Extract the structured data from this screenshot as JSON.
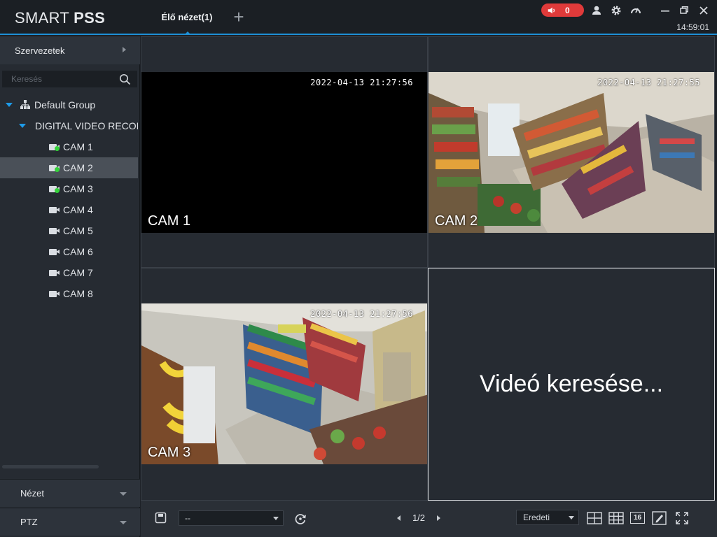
{
  "app": {
    "logo_light": "SMART",
    "logo_bold": "PSS",
    "clock": "14:59:01"
  },
  "tabs": [
    {
      "label": "Élő nézet(1)"
    }
  ],
  "alarm": {
    "count": "0",
    "color": "#e03a3a"
  },
  "accent_color": "#1e90d6",
  "sidebar": {
    "organizations_label": "Szervezetek",
    "search_placeholder": "Keresés",
    "tree": {
      "group": "Default Group",
      "device": "DIGITAL VIDEO RECORDER",
      "cameras": [
        {
          "label": "CAM 1",
          "online": true
        },
        {
          "label": "CAM 2",
          "online": true,
          "selected": true
        },
        {
          "label": "CAM 3",
          "online": true
        },
        {
          "label": "CAM 4",
          "online": false
        },
        {
          "label": "CAM 5",
          "online": false
        },
        {
          "label": "CAM 6",
          "online": false
        },
        {
          "label": "CAM 7",
          "online": false
        },
        {
          "label": "CAM 8",
          "online": false
        }
      ]
    },
    "view_label": "Nézet",
    "ptz_label": "PTZ"
  },
  "video": {
    "tiles": [
      {
        "camera": "CAM 1",
        "timestamp": "2022-04-13 21:27:56"
      },
      {
        "camera": "CAM 2",
        "timestamp": "2022-04-13 21:27:55"
      },
      {
        "camera": "CAM 3",
        "timestamp": "2022-04-13 21:27:56"
      }
    ],
    "searching_text": "Videó keresése..."
  },
  "toolbar": {
    "preset_value": "--",
    "page": "1/2",
    "ratio_value": "Eredeti",
    "layout_16": "16"
  }
}
